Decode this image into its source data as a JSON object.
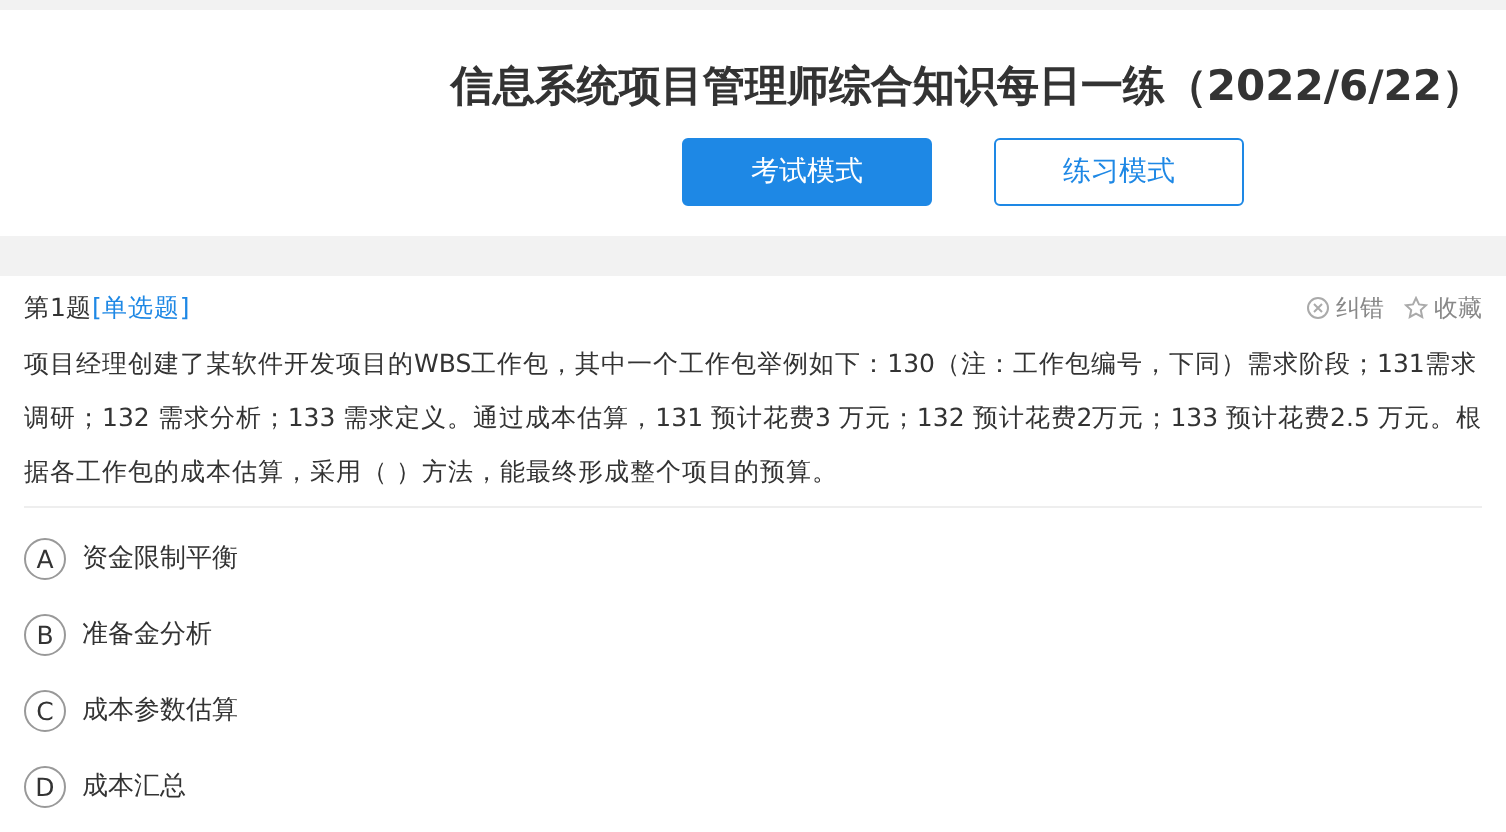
{
  "title": "信息系统项目管理师综合知识每日一练（2022/6/22）",
  "modes": [
    {
      "label": "考试模式",
      "selected": true
    },
    {
      "label": "练习模式",
      "selected": false
    }
  ],
  "question": {
    "number": "第1题",
    "type": "[单选题]",
    "actions": [
      {
        "kind": "report",
        "label": "纠错"
      },
      {
        "kind": "favorite",
        "label": "收藏"
      }
    ],
    "text": "项目经理创建了某软件开发项目的WBS工作包，其中一个工作包举例如下：130（注：工作包编号，下同）需求阶段；131需求调研；132 需求分析；133 需求定义。通过成本估算，131 预计花费3 万元；132 预计花费2万元；133 预计花费2.5 万元。根据各工作包的成本估算，采用（ ）方法，能最终形成整个项目的预算。",
    "options": [
      {
        "letter": "A",
        "text": "资金限制平衡"
      },
      {
        "letter": "B",
        "text": "准备金分析"
      },
      {
        "letter": "C",
        "text": "成本参数估算"
      },
      {
        "letter": "D",
        "text": "成本汇总"
      }
    ]
  }
}
